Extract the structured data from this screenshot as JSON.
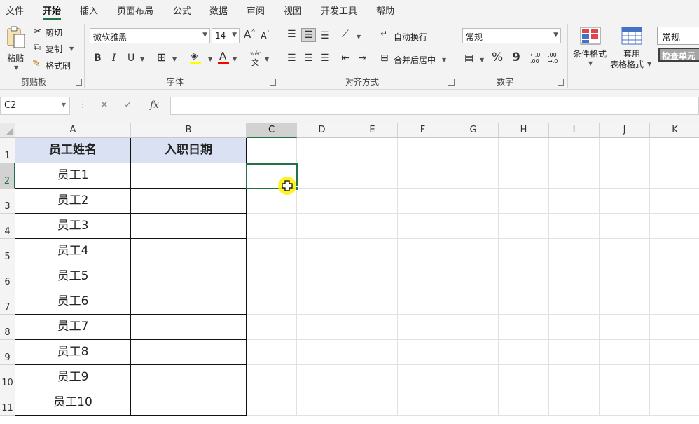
{
  "menu": {
    "tabs": [
      "文件",
      "开始",
      "插入",
      "页面布局",
      "公式",
      "数据",
      "审阅",
      "视图",
      "开发工具",
      "帮助"
    ],
    "active": "开始"
  },
  "ribbon": {
    "clipboard": {
      "paste": "粘贴",
      "cut": "剪切",
      "copy": "复制",
      "format_painter": "格式刷",
      "label": "剪贴板"
    },
    "font": {
      "name": "微软雅黑",
      "size": "14",
      "grow": "A",
      "shrink": "A",
      "bold": "B",
      "italic": "I",
      "underline": "U",
      "font_color": "A",
      "phonetic_top": "wén",
      "phonetic_bottom": "文",
      "label": "字体"
    },
    "alignment": {
      "wrap": "自动换行",
      "merge": "合并后居中",
      "label": "对齐方式"
    },
    "number": {
      "format": "常规",
      "percent": "%",
      "comma": "9",
      "inc_decimal": "←.0 .00",
      "dec_decimal": ".00 →.0",
      "label": "数字"
    },
    "styles": {
      "conditional": "条件格式",
      "table_format_line1": "套用",
      "table_format_line2": "表格格式",
      "cell_style_normal": "常规",
      "cell_style_check": "检查单元"
    }
  },
  "formula_bar": {
    "name_box": "C2",
    "cancel": "✕",
    "enter": "✓",
    "fx": "fx",
    "value": ""
  },
  "sheet": {
    "columns": [
      "A",
      "B",
      "C",
      "D",
      "E",
      "F",
      "G",
      "H",
      "I",
      "J",
      "K"
    ],
    "selected_column": "C",
    "rows": [
      "1",
      "2",
      "3",
      "4",
      "5",
      "6",
      "7",
      "8",
      "9",
      "10",
      "11"
    ],
    "selected_row": "2",
    "header": [
      "员工姓名",
      "入职日期"
    ],
    "employees": [
      "员工1",
      "员工2",
      "员工3",
      "员工4",
      "员工5",
      "员工6",
      "员工7",
      "员工8",
      "员工9",
      "员工10"
    ],
    "active_cell": "C2",
    "header_fill": "#D9E1F2",
    "accent": "#217346"
  }
}
